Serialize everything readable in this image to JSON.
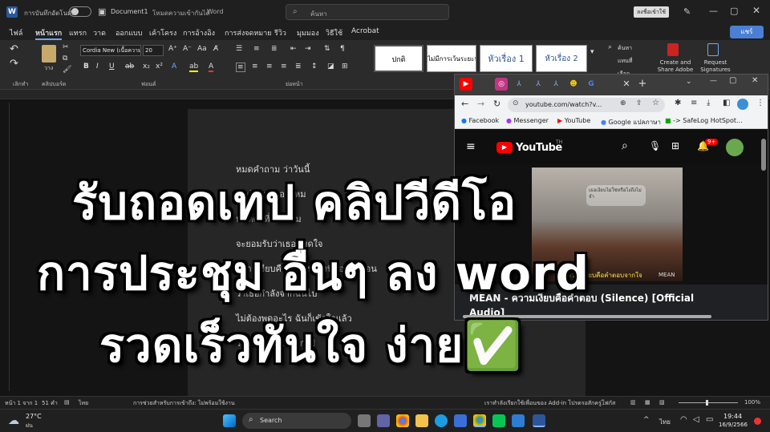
{
  "titlebar": {
    "autosave_label": "การบันทึกอัตโนมัติ",
    "doc_title": "Document1",
    "mode": "โหมดความเข้ากันได้",
    "app": "Word",
    "search_placeholder": "ค้นหา",
    "signin": "ลงชื่อเข้าใช้"
  },
  "menu": {
    "tabs": [
      "ไฟล์",
      "หน้าแรก",
      "แทรก",
      "วาด",
      "ออกแบบ",
      "เค้าโครง",
      "การอ้างอิง",
      "การส่งจดหมาย",
      "รีวิว",
      "มุมมอง",
      "วิธีใช้",
      "Acrobat"
    ],
    "share": "แชร์"
  },
  "ribbon": {
    "font_name": "Cordia New (เนื้อความ",
    "font_size": "20",
    "styles": [
      "ปกติ",
      "ไม่มีการเว้นระยะห่",
      "หัวเรื่อง 1",
      "หัวเรื่อง 2"
    ],
    "find": "ค้นหา",
    "replace": "แทนที่",
    "select": "เลือก",
    "create_share": "Create and Share Adobe PDF",
    "request_sig": "Request Signatures",
    "paste": "วาง",
    "group_labels": [
      "เลิกทำ",
      "คลิปบอร์ด",
      "ฟอนต์",
      "ย่อหน้า"
    ]
  },
  "document": {
    "lines": [
      "หมดคำถาม ว่าวันนี้",
      "เรายังรักกันอยู่ไหม",
      "หมดคำที่ต้องถาม",
      "จะยอมรับว่าเธอหมดใจ",
      "ความเงียบคือการกระทำที่บอกมาก่อน",
      "ว่าเธอกำลังจากฉันไป",
      "ไม่ต้องพูดอะไร ฉันก็เข้าใจแล้ว",
      "ว่าเธอต้องการจากไป"
    ]
  },
  "overlay": {
    "line1": "รับถอดเทป คลิปวีดีโอ",
    "line2": "การประชุม อื่นๆ ลง word",
    "line3": "รวดเร็วทันใจ ง่าย✅"
  },
  "status": {
    "page": "หน้า 1 จาก 1",
    "words": "51 คำ",
    "lang": "ไทย",
    "accessibility": "การช่วยสำหรับการเข้าถึง: ไม่พร้อมใช้งาน",
    "addin": "เราทำลังเรียกใช้เพื่อนของ Add-in โปรดรอสักครู่...",
    "focus": "โฟกัส",
    "zoom": "100%"
  },
  "chrome": {
    "url": "youtube.com/watch?v...",
    "bookmarks": [
      "Facebook",
      "Messenger",
      "YouTube",
      "Google แปลภาษา",
      "-> SafeLog HotSpot..."
    ],
    "yt_logo": "YouTube",
    "yt_region": "TH",
    "notif_count": "9+",
    "video_title": "MEAN - ความเงียบคือคำตอบ (Silence) [Official",
    "video_title2": "Audio]",
    "video_caption": "ความเงียบคือคำตอบจากใจ",
    "video_watermark": "MEAN",
    "bubble": "เธอเงียบไม่ใช่หรือไงถึงไม่จำ"
  },
  "taskbar": {
    "weather_temp": "27°C",
    "weather_desc": "ฝน",
    "search": "Search",
    "lang": "ไทย",
    "time": "19:44",
    "date": "16/9/2566"
  },
  "colors": {
    "accent": "#4a7fd4",
    "yt_red": "#ff0000",
    "check_green": "#2fb344"
  }
}
